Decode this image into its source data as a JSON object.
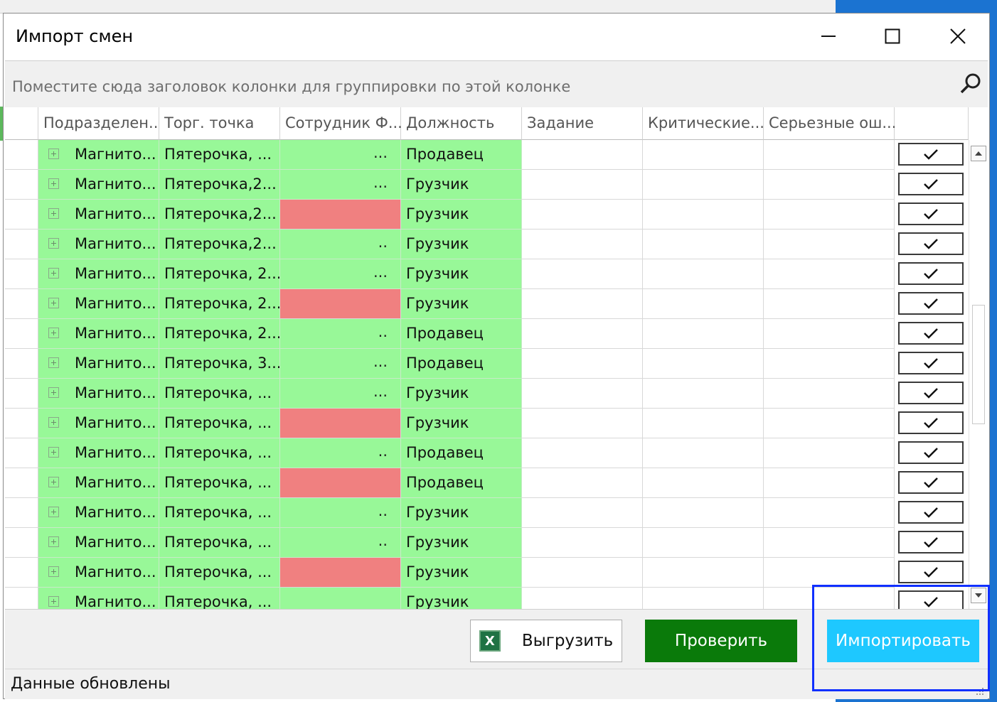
{
  "dialog": {
    "title": "Импорт смен"
  },
  "group_panel": {
    "placeholder": "Поместите сюда заголовок колонки для группировки по этой колонке"
  },
  "columns": [
    {
      "label": "Подразделен..."
    },
    {
      "label": "Торг. точка"
    },
    {
      "label": "Сотрудник Ф..."
    },
    {
      "label": "Должность"
    },
    {
      "label": "Задание"
    },
    {
      "label": "Критические..."
    },
    {
      "label": "Серьезные ош..."
    }
  ],
  "rows": [
    {
      "dept": "Магнито...",
      "store": "Пятерочка, ...",
      "emp_dots": "...",
      "emp_flag": "ok",
      "position": "Продавец",
      "checked": true
    },
    {
      "dept": "Магнито...",
      "store": "Пятерочка,2...",
      "emp_dots": "...",
      "emp_flag": "ok",
      "position": "Грузчик",
      "checked": true
    },
    {
      "dept": "Магнито...",
      "store": "Пятерочка,2...",
      "emp_dots": "",
      "emp_flag": "error",
      "position": "Грузчик",
      "checked": true
    },
    {
      "dept": "Магнито...",
      "store": "Пятерочка,2...",
      "emp_dots": "..",
      "emp_flag": "ok",
      "position": "Грузчик",
      "checked": true
    },
    {
      "dept": "Магнито...",
      "store": "Пятерочка, 2...",
      "emp_dots": "...",
      "emp_flag": "ok",
      "position": "Грузчик",
      "checked": true
    },
    {
      "dept": "Магнито...",
      "store": "Пятерочка, 2...",
      "emp_dots": "",
      "emp_flag": "error",
      "position": "Грузчик",
      "checked": true
    },
    {
      "dept": "Магнито...",
      "store": "Пятерочка, 2...",
      "emp_dots": "..",
      "emp_flag": "ok",
      "position": "Продавец",
      "checked": true
    },
    {
      "dept": "Магнито...",
      "store": "Пятерочка, 3...",
      "emp_dots": "...",
      "emp_flag": "ok",
      "position": "Продавец",
      "checked": true
    },
    {
      "dept": "Магнито...",
      "store": "Пятерочка, ...",
      "emp_dots": "...",
      "emp_flag": "ok",
      "position": "Грузчик",
      "checked": true
    },
    {
      "dept": "Магнито...",
      "store": "Пятерочка, ...",
      "emp_dots": "",
      "emp_flag": "error",
      "position": "Грузчик",
      "checked": true
    },
    {
      "dept": "Магнито...",
      "store": "Пятерочка, ...",
      "emp_dots": "..",
      "emp_flag": "ok",
      "position": "Продавец",
      "checked": true
    },
    {
      "dept": "Магнито...",
      "store": "Пятерочка, ...",
      "emp_dots": "",
      "emp_flag": "error",
      "position": "Продавец",
      "checked": true
    },
    {
      "dept": "Магнито...",
      "store": "Пятерочка, ...",
      "emp_dots": "..",
      "emp_flag": "ok",
      "position": "Грузчик",
      "checked": true
    },
    {
      "dept": "Магнито...",
      "store": "Пятерочка, ...",
      "emp_dots": "..",
      "emp_flag": "ok",
      "position": "Грузчик",
      "checked": true
    },
    {
      "dept": "Магнито...",
      "store": "Пятерочка, ...",
      "emp_dots": "",
      "emp_flag": "error",
      "position": "Грузчик",
      "checked": true
    },
    {
      "dept": "Магнито...",
      "store": "Пятерочка, ...",
      "emp_dots": "",
      "emp_flag": "ok",
      "position": "Грузчик",
      "checked": true
    }
  ],
  "buttons": {
    "export": "Выгрузить",
    "check": "Проверить",
    "import": "Импортировать"
  },
  "status": {
    "text": "Данные обновлены"
  },
  "colors": {
    "row_ok": "#98f898",
    "cell_error": "#f08080",
    "check_button": "#0a7a0a",
    "import_button": "#1ec8ff",
    "highlight_frame": "#1030ff"
  },
  "icons": {
    "export": "excel-icon",
    "search": "search-icon",
    "expand": "plus-box-icon",
    "check": "checkmark-icon"
  }
}
